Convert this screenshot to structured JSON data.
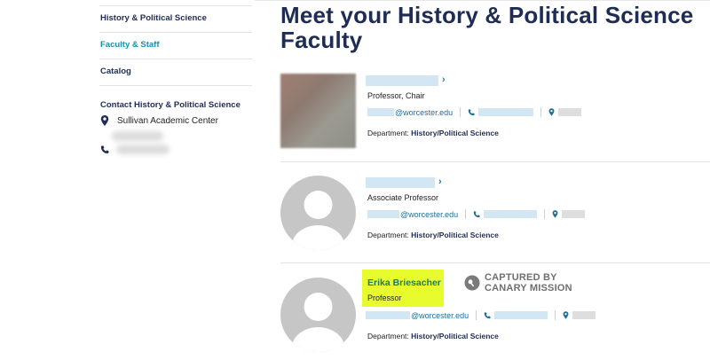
{
  "sidebar": {
    "links": [
      {
        "label": "History & Political Science",
        "active": false
      },
      {
        "label": "Faculty & Staff",
        "active": true
      },
      {
        "label": "Catalog",
        "active": false
      }
    ],
    "contact": {
      "title": "Contact History & Political Science",
      "address": "Sullivan Academic Center"
    }
  },
  "main": {
    "title": "Meet your History & Political Science Faculty",
    "faculty": [
      {
        "title": "Professor, Chair",
        "email_domain": "@worcester.edu",
        "department_label": "Department:",
        "department": "History/Political Science"
      },
      {
        "title": "Associate Professor",
        "email_domain": "@worcester.edu",
        "department_label": "Department:",
        "department": "History/Political Science"
      },
      {
        "name": "Erika Briesacher",
        "title": "Professor",
        "email_domain": "@worcester.edu",
        "department_label": "Department:",
        "department": "History/Political Science"
      }
    ]
  },
  "watermark": {
    "line1": "CAPTURED BY",
    "line2": "CANARY MISSION"
  },
  "colors": {
    "navy": "#1f2d54",
    "teal": "#1b8fa8",
    "highlight": "#e8fb2c",
    "link": "#1b6f98"
  }
}
